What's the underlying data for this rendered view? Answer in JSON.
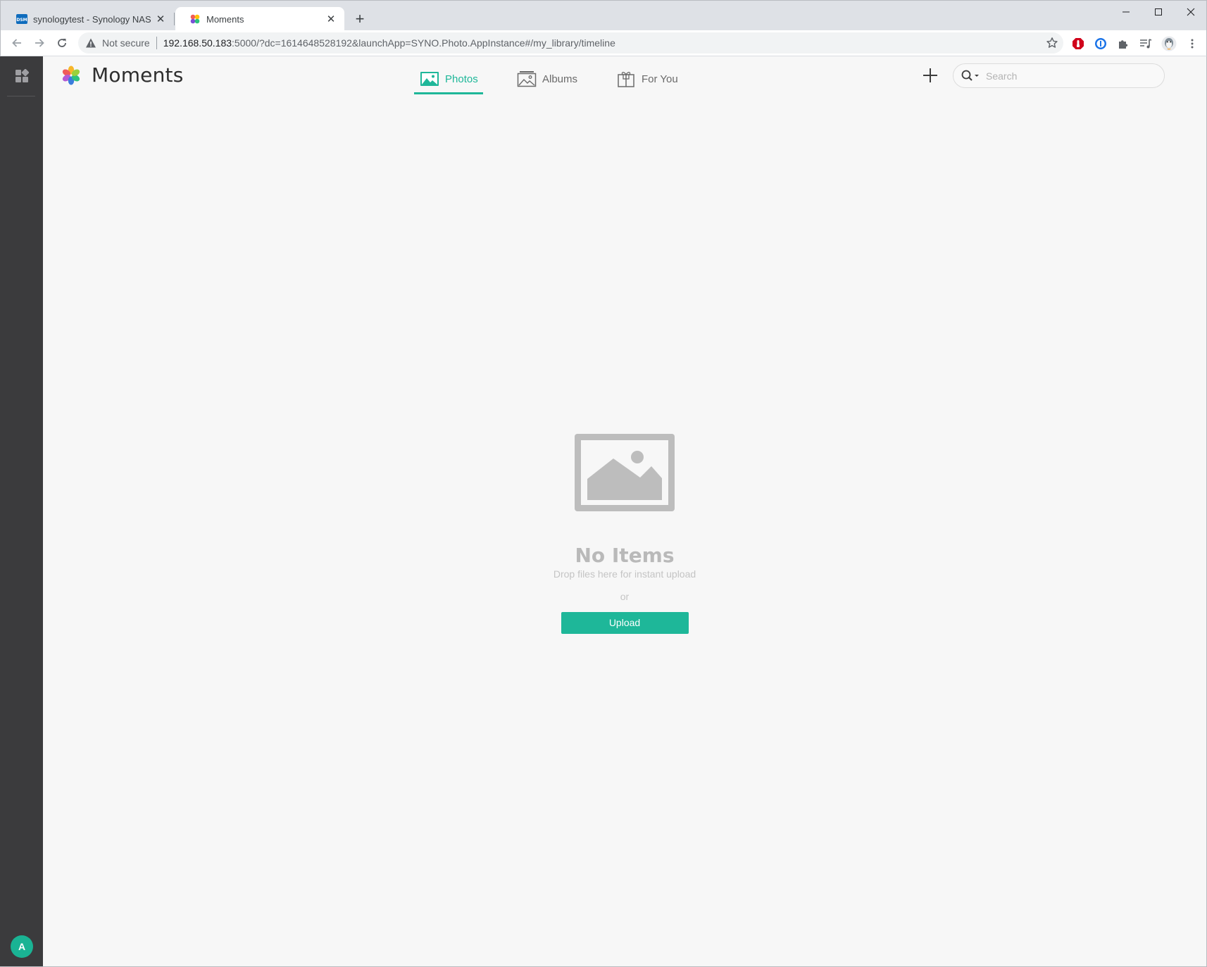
{
  "browser": {
    "tabs": [
      {
        "title": "synologytest - Synology NAS",
        "favicon": "dsm-favicon",
        "active": false
      },
      {
        "title": "Moments",
        "favicon": "moments-favicon",
        "active": true
      }
    ],
    "address": {
      "security_label": "Not secure",
      "url_host": "192.168.50.183",
      "url_path": ":5000/?dc=1614648528192&launchApp=SYNO.Photo.AppInstance#/my_library/timeline"
    },
    "dsm_favicon_text": "DSM"
  },
  "app": {
    "title": "Moments",
    "nav": [
      {
        "label": "Photos",
        "icon": "photo-icon",
        "active": true
      },
      {
        "label": "Albums",
        "icon": "albums-icon",
        "active": false
      },
      {
        "label": "For You",
        "icon": "gift-icon",
        "active": false
      }
    ],
    "search": {
      "placeholder": "Search"
    },
    "user_avatar_initial": "A"
  },
  "empty_state": {
    "title": "No Items",
    "subtitle": "Drop files here for instant upload",
    "or_text": "or",
    "upload_label": "Upload"
  },
  "colors": {
    "accent": "#1eb799",
    "sidebar": "#3b3b3d",
    "background": "#f7f7f7",
    "placeholder_icon": "#bdbdbd"
  }
}
